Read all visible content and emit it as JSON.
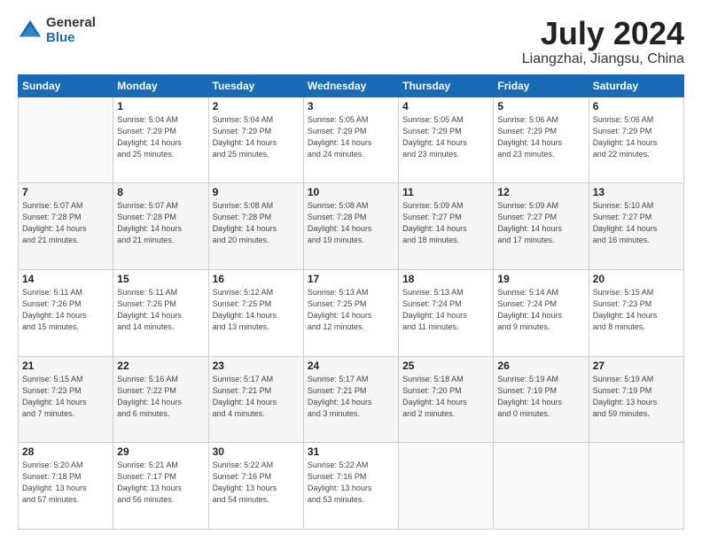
{
  "header": {
    "logo_general": "General",
    "logo_blue": "Blue",
    "title": "July 2024",
    "subtitle": "Liangzhai, Jiangsu, China"
  },
  "calendar": {
    "days_of_week": [
      "Sunday",
      "Monday",
      "Tuesday",
      "Wednesday",
      "Thursday",
      "Friday",
      "Saturday"
    ],
    "weeks": [
      [
        {
          "day": "",
          "info": ""
        },
        {
          "day": "1",
          "info": "Sunrise: 5:04 AM\nSunset: 7:29 PM\nDaylight: 14 hours\nand 25 minutes."
        },
        {
          "day": "2",
          "info": "Sunrise: 5:04 AM\nSunset: 7:29 PM\nDaylight: 14 hours\nand 25 minutes."
        },
        {
          "day": "3",
          "info": "Sunrise: 5:05 AM\nSunset: 7:29 PM\nDaylight: 14 hours\nand 24 minutes."
        },
        {
          "day": "4",
          "info": "Sunrise: 5:05 AM\nSunset: 7:29 PM\nDaylight: 14 hours\nand 23 minutes."
        },
        {
          "day": "5",
          "info": "Sunrise: 5:06 AM\nSunset: 7:29 PM\nDaylight: 14 hours\nand 23 minutes."
        },
        {
          "day": "6",
          "info": "Sunrise: 5:06 AM\nSunset: 7:29 PM\nDaylight: 14 hours\nand 22 minutes."
        }
      ],
      [
        {
          "day": "7",
          "info": "Sunrise: 5:07 AM\nSunset: 7:28 PM\nDaylight: 14 hours\nand 21 minutes."
        },
        {
          "day": "8",
          "info": "Sunrise: 5:07 AM\nSunset: 7:28 PM\nDaylight: 14 hours\nand 21 minutes."
        },
        {
          "day": "9",
          "info": "Sunrise: 5:08 AM\nSunset: 7:28 PM\nDaylight: 14 hours\nand 20 minutes."
        },
        {
          "day": "10",
          "info": "Sunrise: 5:08 AM\nSunset: 7:28 PM\nDaylight: 14 hours\nand 19 minutes."
        },
        {
          "day": "11",
          "info": "Sunrise: 5:09 AM\nSunset: 7:27 PM\nDaylight: 14 hours\nand 18 minutes."
        },
        {
          "day": "12",
          "info": "Sunrise: 5:09 AM\nSunset: 7:27 PM\nDaylight: 14 hours\nand 17 minutes."
        },
        {
          "day": "13",
          "info": "Sunrise: 5:10 AM\nSunset: 7:27 PM\nDaylight: 14 hours\nand 16 minutes."
        }
      ],
      [
        {
          "day": "14",
          "info": "Sunrise: 5:11 AM\nSunset: 7:26 PM\nDaylight: 14 hours\nand 15 minutes."
        },
        {
          "day": "15",
          "info": "Sunrise: 5:11 AM\nSunset: 7:26 PM\nDaylight: 14 hours\nand 14 minutes."
        },
        {
          "day": "16",
          "info": "Sunrise: 5:12 AM\nSunset: 7:25 PM\nDaylight: 14 hours\nand 13 minutes."
        },
        {
          "day": "17",
          "info": "Sunrise: 5:13 AM\nSunset: 7:25 PM\nDaylight: 14 hours\nand 12 minutes."
        },
        {
          "day": "18",
          "info": "Sunrise: 5:13 AM\nSunset: 7:24 PM\nDaylight: 14 hours\nand 11 minutes."
        },
        {
          "day": "19",
          "info": "Sunrise: 5:14 AM\nSunset: 7:24 PM\nDaylight: 14 hours\nand 9 minutes."
        },
        {
          "day": "20",
          "info": "Sunrise: 5:15 AM\nSunset: 7:23 PM\nDaylight: 14 hours\nand 8 minutes."
        }
      ],
      [
        {
          "day": "21",
          "info": "Sunrise: 5:15 AM\nSunset: 7:23 PM\nDaylight: 14 hours\nand 7 minutes."
        },
        {
          "day": "22",
          "info": "Sunrise: 5:16 AM\nSunset: 7:22 PM\nDaylight: 14 hours\nand 6 minutes."
        },
        {
          "day": "23",
          "info": "Sunrise: 5:17 AM\nSunset: 7:21 PM\nDaylight: 14 hours\nand 4 minutes."
        },
        {
          "day": "24",
          "info": "Sunrise: 5:17 AM\nSunset: 7:21 PM\nDaylight: 14 hours\nand 3 minutes."
        },
        {
          "day": "25",
          "info": "Sunrise: 5:18 AM\nSunset: 7:20 PM\nDaylight: 14 hours\nand 2 minutes."
        },
        {
          "day": "26",
          "info": "Sunrise: 5:19 AM\nSunset: 7:19 PM\nDaylight: 14 hours\nand 0 minutes."
        },
        {
          "day": "27",
          "info": "Sunrise: 5:19 AM\nSunset: 7:19 PM\nDaylight: 13 hours\nand 59 minutes."
        }
      ],
      [
        {
          "day": "28",
          "info": "Sunrise: 5:20 AM\nSunset: 7:18 PM\nDaylight: 13 hours\nand 57 minutes."
        },
        {
          "day": "29",
          "info": "Sunrise: 5:21 AM\nSunset: 7:17 PM\nDaylight: 13 hours\nand 56 minutes."
        },
        {
          "day": "30",
          "info": "Sunrise: 5:22 AM\nSunset: 7:16 PM\nDaylight: 13 hours\nand 54 minutes."
        },
        {
          "day": "31",
          "info": "Sunrise: 5:22 AM\nSunset: 7:16 PM\nDaylight: 13 hours\nand 53 minutes."
        },
        {
          "day": "",
          "info": ""
        },
        {
          "day": "",
          "info": ""
        },
        {
          "day": "",
          "info": ""
        }
      ]
    ]
  }
}
